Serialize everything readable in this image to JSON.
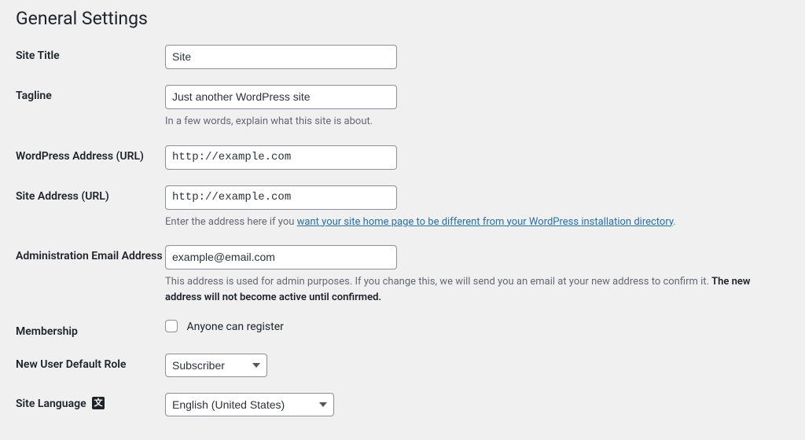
{
  "page_title": "General Settings",
  "fields": {
    "site_title": {
      "label": "Site Title",
      "value": "Site"
    },
    "tagline": {
      "label": "Tagline",
      "value": "Just another WordPress site",
      "description": "In a few words, explain what this site is about."
    },
    "wp_address": {
      "label": "WordPress Address (URL)",
      "value": "http://example.com"
    },
    "site_address": {
      "label": "Site Address (URL)",
      "value": "http://example.com",
      "description_prefix": "Enter the address here if you ",
      "description_link": "want your site home page to be different from your WordPress installation directory",
      "description_suffix": "."
    },
    "admin_email": {
      "label": "Administration Email Address",
      "value": "example@email.com",
      "description_prefix": "This address is used for admin purposes. If you change this, we will send you an email at your new address to confirm it. ",
      "description_bold": "The new address will not become active until confirmed."
    },
    "membership": {
      "label": "Membership",
      "checkbox_label": "Anyone can register",
      "checked": false
    },
    "default_role": {
      "label": "New User Default Role",
      "selected": "Subscriber"
    },
    "site_language": {
      "label": "Site Language",
      "selected": "English (United States)"
    }
  }
}
